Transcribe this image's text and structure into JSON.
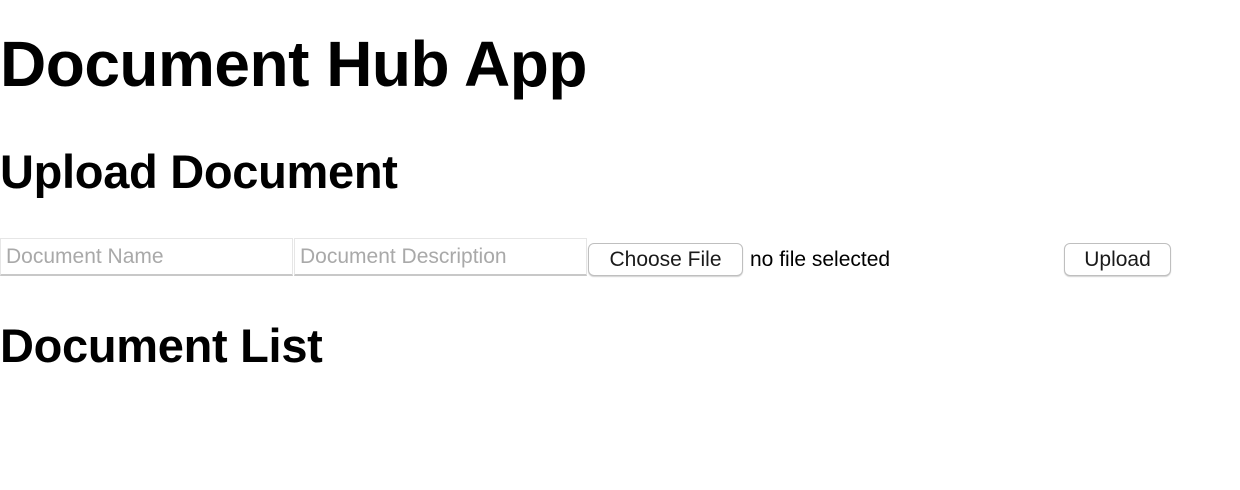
{
  "app": {
    "title": "Document Hub App"
  },
  "upload": {
    "heading": "Upload Document",
    "name_placeholder": "Document Name",
    "name_value": "",
    "description_placeholder": "Document Description",
    "description_value": "",
    "choose_file_label": "Choose File",
    "file_status": "no file selected",
    "submit_label": "Upload"
  },
  "list": {
    "heading": "Document List",
    "items": []
  }
}
